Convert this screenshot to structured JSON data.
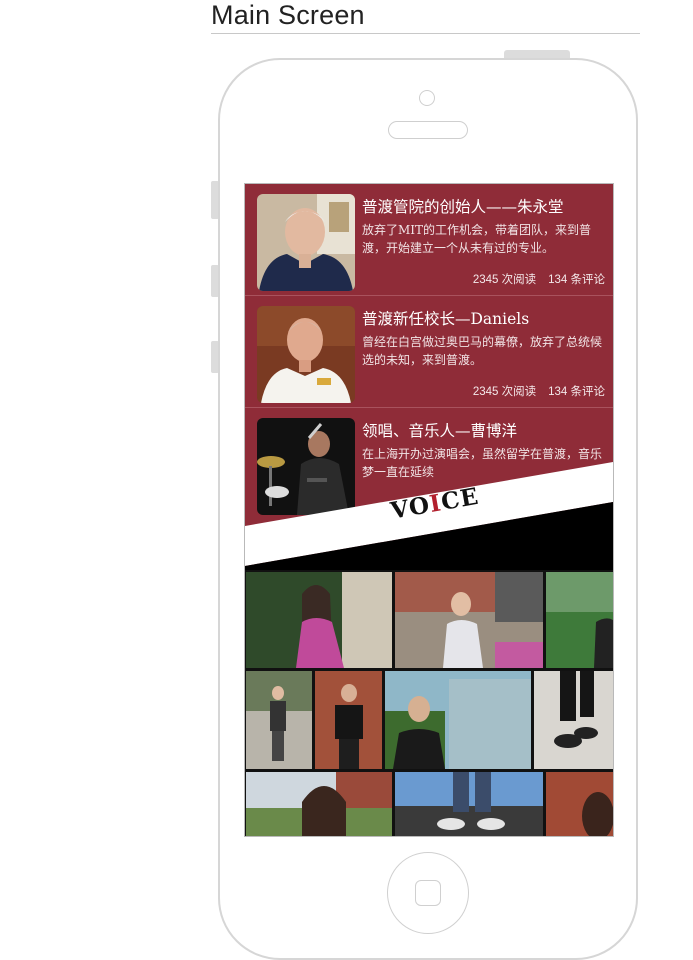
{
  "page": {
    "title": "Main Screen"
  },
  "articles": [
    {
      "title": "普渡管院的创始人——朱永堂",
      "desc": "放弃了MIT的工作机会，带着团队，来到普渡，开始建立一个从未有过的专业。",
      "reads": "2345 次阅读",
      "comments": "134 条评论"
    },
    {
      "title": "普渡新任校长—Daniels",
      "desc": "曾经在白宫做过奥巴马的幕僚，放弃了总统候选的未知，来到普渡。",
      "reads": "2345 次阅读",
      "comments": "134 条评论"
    },
    {
      "title": "领唱、音乐人—曹博洋",
      "desc": "在上海开办过演唱会，虽然留学在普渡，音乐梦一直在延续"
    }
  ],
  "banner": {
    "text_a": "VO",
    "text_accent": "I",
    "text_b": "CE"
  },
  "colors": {
    "accent": "#8f2c38",
    "banner_black": "#000000",
    "banner_white": "#ffffff"
  },
  "icons": {
    "home": "home-button-icon",
    "camera": "front-camera-icon",
    "speaker": "speaker-icon"
  }
}
